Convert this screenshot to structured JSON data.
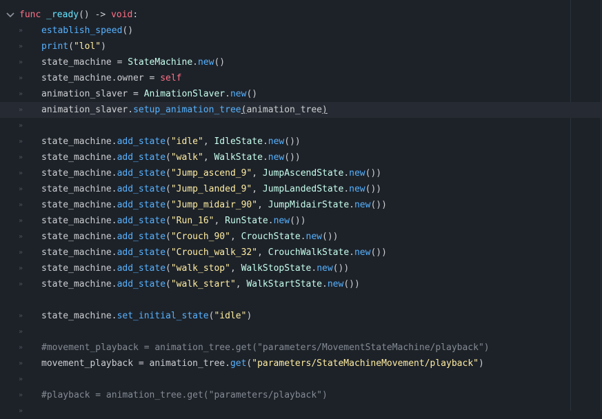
{
  "editor": {
    "lines": [
      {
        "segments": [
          {
            "t": "func",
            "c": "kw"
          },
          {
            "t": " ",
            "c": "txt"
          },
          {
            "t": "_ready",
            "c": "def"
          },
          {
            "t": "() -> ",
            "c": "txt"
          },
          {
            "t": "void",
            "c": "kw"
          },
          {
            "t": ":",
            "c": "txt"
          }
        ]
      },
      {
        "segments": [
          {
            "t": "establish_speed",
            "c": "fn"
          },
          {
            "t": "()",
            "c": "txt"
          }
        ]
      },
      {
        "segments": [
          {
            "t": "print",
            "c": "fn"
          },
          {
            "t": "(",
            "c": "txt"
          },
          {
            "t": "\"lol\"",
            "c": "str"
          },
          {
            "t": ")",
            "c": "txt"
          }
        ]
      },
      {
        "segments": [
          {
            "t": "state_machine = ",
            "c": "txt"
          },
          {
            "t": "StateMachine",
            "c": "cls"
          },
          {
            "t": ".",
            "c": "txt"
          },
          {
            "t": "new",
            "c": "fn"
          },
          {
            "t": "()",
            "c": "txt"
          }
        ]
      },
      {
        "segments": [
          {
            "t": "state_machine.owner = ",
            "c": "txt"
          },
          {
            "t": "self",
            "c": "kw"
          }
        ]
      },
      {
        "segments": [
          {
            "t": "animation_slaver = ",
            "c": "txt"
          },
          {
            "t": "AnimationSlaver",
            "c": "cls"
          },
          {
            "t": ".",
            "c": "txt"
          },
          {
            "t": "new",
            "c": "fn"
          },
          {
            "t": "()",
            "c": "txt"
          }
        ]
      },
      {
        "segments": [
          {
            "t": "animation_slaver.",
            "c": "txt"
          },
          {
            "t": "setup_animation_tree",
            "c": "fn"
          },
          {
            "t": "(",
            "c": "brace"
          },
          {
            "t": "animation_tree",
            "c": "txt"
          },
          {
            "t": ")",
            "c": "brace"
          }
        ]
      },
      {
        "segments": []
      },
      {
        "segments": [
          {
            "t": "state_machine.",
            "c": "txt"
          },
          {
            "t": "add_state",
            "c": "fn"
          },
          {
            "t": "(",
            "c": "txt"
          },
          {
            "t": "\"idle\"",
            "c": "str"
          },
          {
            "t": ", ",
            "c": "txt"
          },
          {
            "t": "IdleState",
            "c": "cls"
          },
          {
            "t": ".",
            "c": "txt"
          },
          {
            "t": "new",
            "c": "fn"
          },
          {
            "t": "())",
            "c": "txt"
          }
        ]
      },
      {
        "segments": [
          {
            "t": "state_machine.",
            "c": "txt"
          },
          {
            "t": "add_state",
            "c": "fn"
          },
          {
            "t": "(",
            "c": "txt"
          },
          {
            "t": "\"walk\"",
            "c": "str"
          },
          {
            "t": ", ",
            "c": "txt"
          },
          {
            "t": "WalkState",
            "c": "cls"
          },
          {
            "t": ".",
            "c": "txt"
          },
          {
            "t": "new",
            "c": "fn"
          },
          {
            "t": "())",
            "c": "txt"
          }
        ]
      },
      {
        "segments": [
          {
            "t": "state_machine.",
            "c": "txt"
          },
          {
            "t": "add_state",
            "c": "fn"
          },
          {
            "t": "(",
            "c": "txt"
          },
          {
            "t": "\"Jump_ascend_9\"",
            "c": "str"
          },
          {
            "t": ", ",
            "c": "txt"
          },
          {
            "t": "JumpAscendState",
            "c": "cls"
          },
          {
            "t": ".",
            "c": "txt"
          },
          {
            "t": "new",
            "c": "fn"
          },
          {
            "t": "())",
            "c": "txt"
          }
        ]
      },
      {
        "segments": [
          {
            "t": "state_machine.",
            "c": "txt"
          },
          {
            "t": "add_state",
            "c": "fn"
          },
          {
            "t": "(",
            "c": "txt"
          },
          {
            "t": "\"Jump_landed_9\"",
            "c": "str"
          },
          {
            "t": ", ",
            "c": "txt"
          },
          {
            "t": "JumpLandedState",
            "c": "cls"
          },
          {
            "t": ".",
            "c": "txt"
          },
          {
            "t": "new",
            "c": "fn"
          },
          {
            "t": "())",
            "c": "txt"
          }
        ]
      },
      {
        "segments": [
          {
            "t": "state_machine.",
            "c": "txt"
          },
          {
            "t": "add_state",
            "c": "fn"
          },
          {
            "t": "(",
            "c": "txt"
          },
          {
            "t": "\"Jump_midair_90\"",
            "c": "str"
          },
          {
            "t": ", ",
            "c": "txt"
          },
          {
            "t": "JumpMidairState",
            "c": "cls"
          },
          {
            "t": ".",
            "c": "txt"
          },
          {
            "t": "new",
            "c": "fn"
          },
          {
            "t": "())",
            "c": "txt"
          }
        ]
      },
      {
        "segments": [
          {
            "t": "state_machine.",
            "c": "txt"
          },
          {
            "t": "add_state",
            "c": "fn"
          },
          {
            "t": "(",
            "c": "txt"
          },
          {
            "t": "\"Run_16\"",
            "c": "str"
          },
          {
            "t": ", ",
            "c": "txt"
          },
          {
            "t": "RunState",
            "c": "cls"
          },
          {
            "t": ".",
            "c": "txt"
          },
          {
            "t": "new",
            "c": "fn"
          },
          {
            "t": "())",
            "c": "txt"
          }
        ]
      },
      {
        "segments": [
          {
            "t": "state_machine.",
            "c": "txt"
          },
          {
            "t": "add_state",
            "c": "fn"
          },
          {
            "t": "(",
            "c": "txt"
          },
          {
            "t": "\"Crouch_90\"",
            "c": "str"
          },
          {
            "t": ", ",
            "c": "txt"
          },
          {
            "t": "CrouchState",
            "c": "cls"
          },
          {
            "t": ".",
            "c": "txt"
          },
          {
            "t": "new",
            "c": "fn"
          },
          {
            "t": "())",
            "c": "txt"
          }
        ]
      },
      {
        "segments": [
          {
            "t": "state_machine.",
            "c": "txt"
          },
          {
            "t": "add_state",
            "c": "fn"
          },
          {
            "t": "(",
            "c": "txt"
          },
          {
            "t": "\"Crouch_walk_32\"",
            "c": "str"
          },
          {
            "t": ", ",
            "c": "txt"
          },
          {
            "t": "CrouchWalkState",
            "c": "cls"
          },
          {
            "t": ".",
            "c": "txt"
          },
          {
            "t": "new",
            "c": "fn"
          },
          {
            "t": "())",
            "c": "txt"
          }
        ]
      },
      {
        "segments": [
          {
            "t": "state_machine.",
            "c": "txt"
          },
          {
            "t": "add_state",
            "c": "fn"
          },
          {
            "t": "(",
            "c": "txt"
          },
          {
            "t": "\"walk_stop\"",
            "c": "str"
          },
          {
            "t": ", ",
            "c": "txt"
          },
          {
            "t": "WalkStopState",
            "c": "cls"
          },
          {
            "t": ".",
            "c": "txt"
          },
          {
            "t": "new",
            "c": "fn"
          },
          {
            "t": "())",
            "c": "txt"
          }
        ]
      },
      {
        "segments": [
          {
            "t": "state_machine.",
            "c": "txt"
          },
          {
            "t": "add_state",
            "c": "fn"
          },
          {
            "t": "(",
            "c": "txt"
          },
          {
            "t": "\"walk_start\"",
            "c": "str"
          },
          {
            "t": ", ",
            "c": "txt"
          },
          {
            "t": "WalkStartState",
            "c": "cls"
          },
          {
            "t": ".",
            "c": "txt"
          },
          {
            "t": "new",
            "c": "fn"
          },
          {
            "t": "())",
            "c": "txt"
          }
        ]
      },
      {
        "segments": []
      },
      {
        "segments": [
          {
            "t": "state_machine.",
            "c": "txt"
          },
          {
            "t": "set_initial_state",
            "c": "fn"
          },
          {
            "t": "(",
            "c": "txt"
          },
          {
            "t": "\"idle\"",
            "c": "str"
          },
          {
            "t": ")",
            "c": "txt"
          }
        ]
      },
      {
        "segments": []
      },
      {
        "segments": [
          {
            "t": "#movement_playback = animation_tree.get(\"parameters/MovementStateMachine/playback\")",
            "c": "cmt"
          }
        ]
      },
      {
        "segments": [
          {
            "t": "movement_playback = animation_tree.",
            "c": "txt"
          },
          {
            "t": "get",
            "c": "fn"
          },
          {
            "t": "(",
            "c": "txt"
          },
          {
            "t": "\"parameters/StateMachineMovement/playback\"",
            "c": "str"
          },
          {
            "t": ")",
            "c": "txt"
          }
        ]
      },
      {
        "segments": []
      },
      {
        "segments": [
          {
            "t": "#playback = animation_tree.get(\"parameters/playback\")",
            "c": "cmt"
          }
        ]
      },
      {
        "segments": []
      }
    ],
    "tab_marker": "»",
    "current_line_index": 6,
    "tab_marker_hidden_lines": [
      0,
      18
    ],
    "fold_icon": "chevron-down-icon",
    "colors": {
      "background": "#1d2229",
      "current_line": "#262b33",
      "keyword": "#ff7085",
      "function": "#57b2ff",
      "class": "#c7ffed",
      "string": "#ffeda1",
      "comment": "#858b93",
      "text": "#cdcfd2"
    }
  }
}
